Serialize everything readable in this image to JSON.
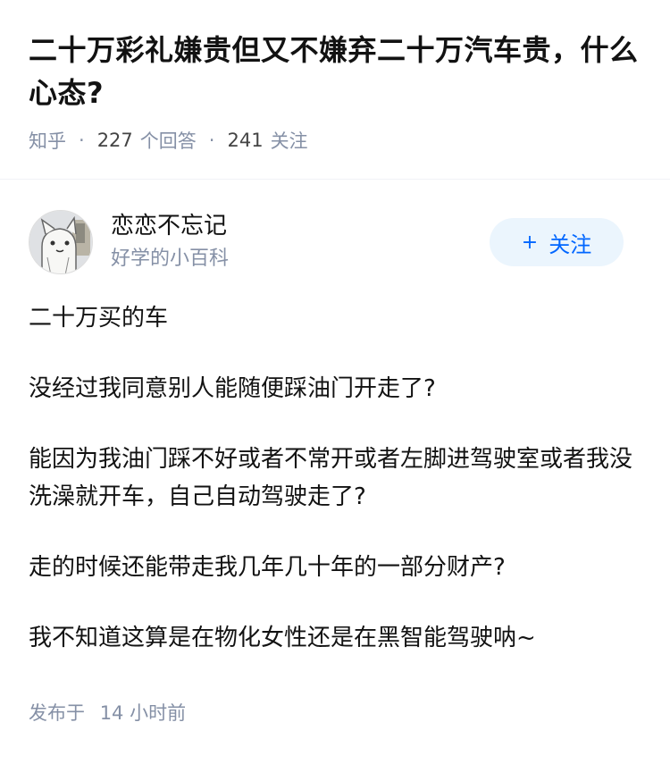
{
  "question": {
    "title": "二十万彩礼嫌贵但又不嫌弃二十万汽车贵，什么心态?",
    "source": "知乎",
    "answer_count": "227",
    "answer_label": "个回答",
    "follower_count": "241",
    "follower_label": "关注"
  },
  "author": {
    "name": "恋恋不忘记",
    "badge": "好学的小百科",
    "follow_plus": "+",
    "follow_label": "关注"
  },
  "answer": {
    "paragraphs": [
      "二十万买的车",
      "没经过我同意别人能随便踩油门开走了?",
      "能因为我油门踩不好或者不常开或者左脚进驾驶室或者我没洗澡就开车，自己自动驾驶走了?",
      "走的时候还能带走我几年几十年的一部分财产?",
      "我不知道这算是在物化女性还是在黑智能驾驶呐~"
    ],
    "posted_label": "发布于",
    "posted_time": "14 小时前"
  },
  "colors": {
    "meta_gray": "#8590a6",
    "accent_blue": "#0066ff",
    "follow_bg": "#ebf5fd"
  }
}
